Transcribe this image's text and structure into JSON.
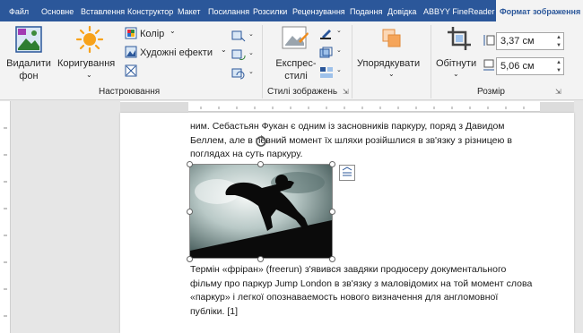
{
  "tabs": [
    "Файл",
    "Основне",
    "Вставлення",
    "Конструктор",
    "Макет",
    "Посилання",
    "Розсилки",
    "Рецензування",
    "Подання",
    "Довідка",
    "ABBYY FineReader 12",
    "Формат зображення"
  ],
  "ribbon": {
    "remove_bg": [
      "Видалити",
      "фон"
    ],
    "corrections": "Коригування",
    "color": "Колір",
    "art_effects": "Художні ефекти",
    "group_adjust": "Настроювання",
    "express_styles": [
      "Експрес-",
      "стилі"
    ],
    "group_styles": "Стилі зображень",
    "arrange": "Упорядкувати",
    "crop": "Обітнути",
    "height": "3,37 см",
    "width": "5,06 см",
    "group_size": "Розмір"
  },
  "document": {
    "para1": [
      "ним. Себастьян Фукан є одним із засновників паркуру, поряд з Давидом",
      "Беллем, але в певний момент їх шляхи розійшлися в зв'язку з різницею в",
      "поглядах на суть паркуру."
    ],
    "para2": [
      "Термін «фріран» (freerun) з'явився завдяки продюсеру документального",
      "фільму про паркур Jump London в зв'язку з маловідомих на той момент слова",
      "«паркур» і легкої опознаваемость нового визначення для англомовної",
      "публіки. [1]"
    ]
  },
  "colors": {
    "tabbar": "#2b579a",
    "ribbon": "#f3f3f3",
    "accent": "#2b579a"
  }
}
